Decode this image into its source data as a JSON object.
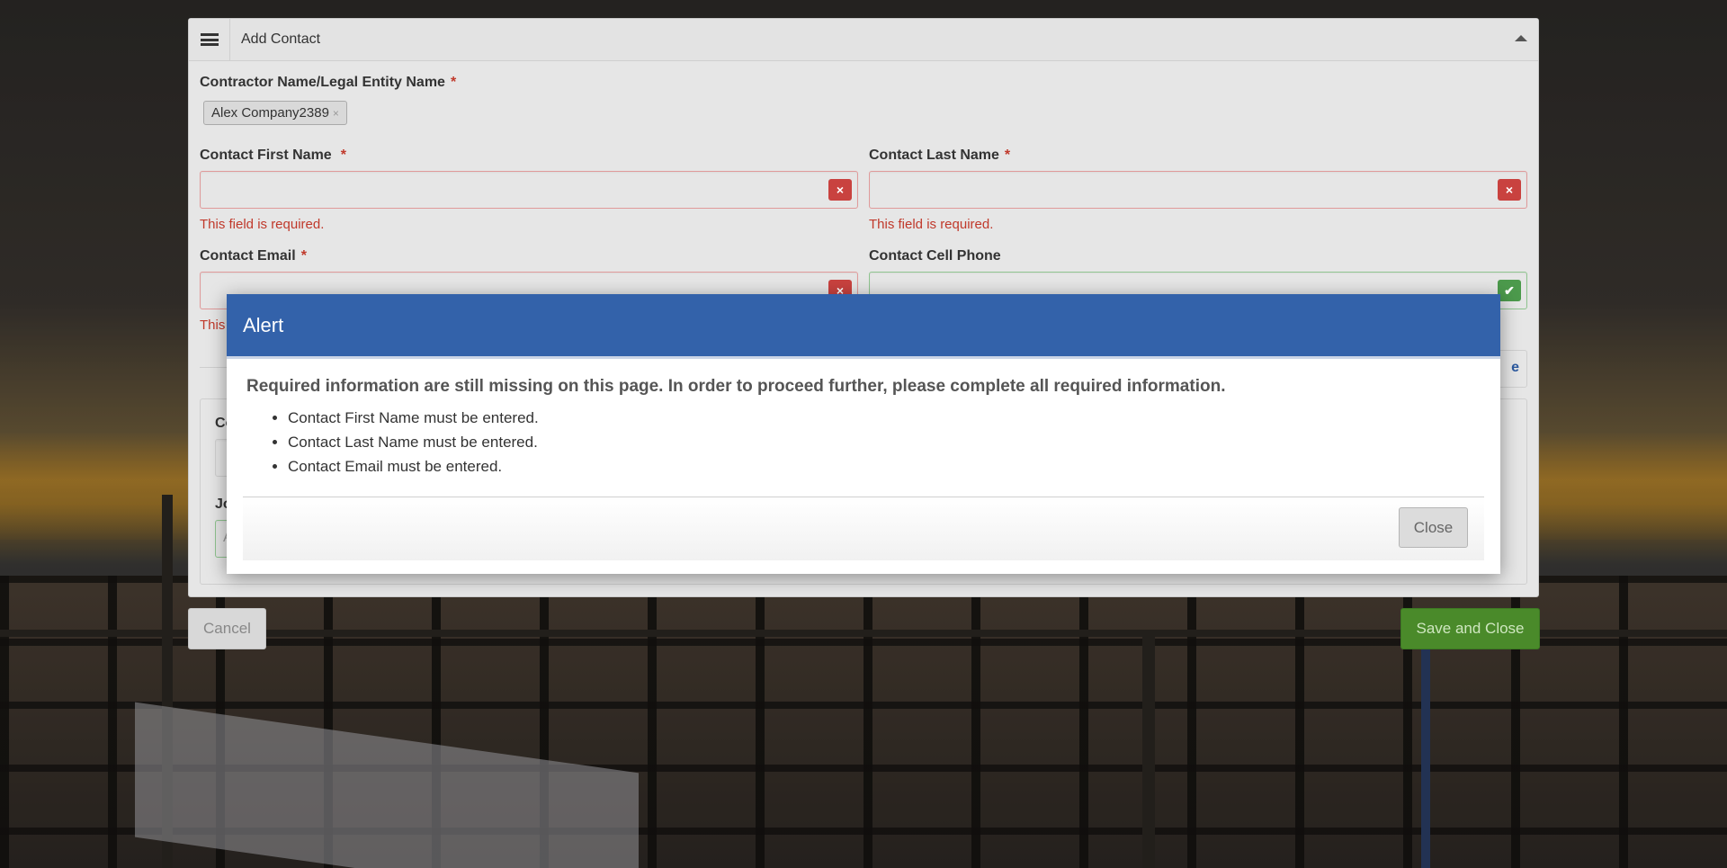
{
  "panel": {
    "title": "Add Contact",
    "contractor_label": "Contractor Name/Legal Entity Name",
    "contractor_tag": "Alex Company2389",
    "first_name_label": "Contact First Name",
    "last_name_label": "Contact Last Name",
    "email_label": "Contact Email",
    "cell_label": "Contact Cell Phone",
    "required_marker": "*",
    "error_text": "This field is required.",
    "error_text_partial": "This",
    "obscured_label_1": "Co",
    "obscured_label_2": "Jo",
    "obscured_value": "A",
    "obscured_button_text": "e"
  },
  "actions": {
    "cancel_label": "Cancel",
    "save_label": "Save and Close"
  },
  "modal": {
    "title": "Alert",
    "message": "Required information are still missing on this page. In order to proceed further, please complete all required information.",
    "items": [
      "Contact First Name must be entered.",
      "Contact Last Name must be entered.",
      "Contact Email must be entered."
    ],
    "close_label": "Close"
  },
  "icons": {
    "error": "×",
    "valid": "✔",
    "tag_remove": "×"
  },
  "colors": {
    "modal_header": "#3362aa",
    "error": "#c0392b",
    "success": "#4a8a2a"
  }
}
